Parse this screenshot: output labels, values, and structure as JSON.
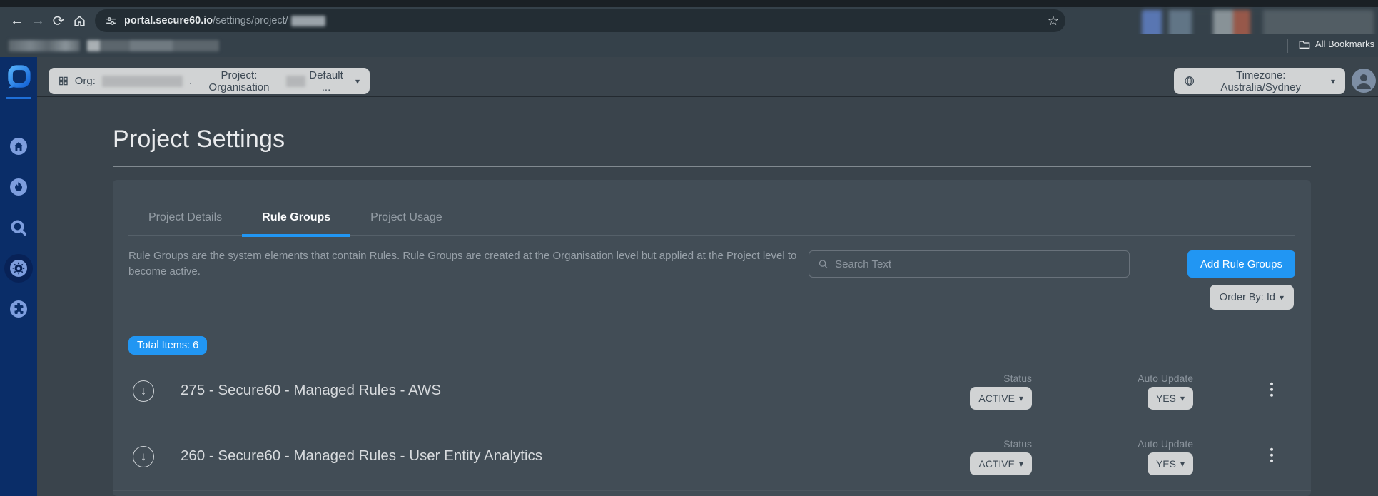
{
  "browser": {
    "url_host": "portal.secure60.io",
    "url_path": "/settings/project/",
    "all_bookmarks_label": "All Bookmarks"
  },
  "header": {
    "org_label": "Org:",
    "org_dot": ".",
    "project_label": "Project: Organisation",
    "project_tail": "Default ...",
    "timezone_label": "Timezone: Australia/Sydney"
  },
  "page": {
    "title": "Project Settings"
  },
  "tabs": [
    {
      "label": "Project Details"
    },
    {
      "label": "Rule Groups"
    },
    {
      "label": "Project Usage"
    }
  ],
  "rule_groups": {
    "description": "Rule Groups are the system elements that contain Rules. Rule Groups are created at the Organisation level but applied at the Project level to become active.",
    "search_placeholder": "Search Text",
    "add_button_label": "Add Rule Groups",
    "order_by_label": "Order By: Id",
    "total_items_label": "Total Items: 6",
    "rows": [
      {
        "title": "275 - Secure60 - Managed Rules - AWS",
        "status_label": "Status",
        "status_value": "ACTIVE",
        "auto_update_label": "Auto Update",
        "auto_update_value": "YES"
      },
      {
        "title": "260 - Secure60 - Managed Rules - User Entity Analytics",
        "status_label": "Status",
        "status_value": "ACTIVE",
        "auto_update_label": "Auto Update",
        "auto_update_value": "YES"
      }
    ]
  },
  "colors": {
    "accent_blue": "#2196f3",
    "sidebar_blue": "#0a2d68",
    "pill_gray": "#d1d3d4",
    "page_bg": "#3a444c",
    "panel_bg": "#424d56"
  }
}
